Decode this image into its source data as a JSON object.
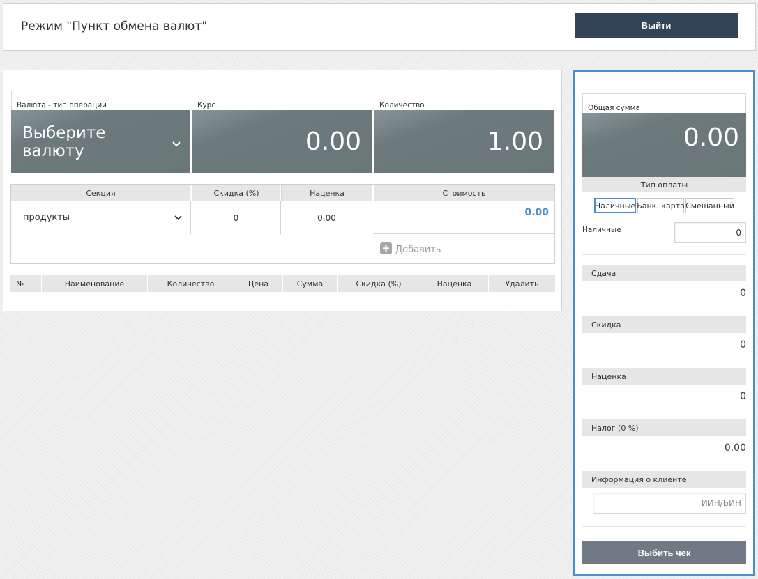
{
  "header": {
    "title": "Режим \"Пункт обмена валют\"",
    "logout_label": "Выйти"
  },
  "exchange": {
    "currency_label": "Валюта - тип операции",
    "currency_value": "Выберите валюту",
    "rate_label": "Курс",
    "rate_value": "0.00",
    "quantity_label": "Количество",
    "quantity_value": "1.00"
  },
  "item": {
    "section_label": "Секция",
    "section_value": "продукты",
    "discount_label": "Скидка (%)",
    "discount_value": "0",
    "markup_label": "Наценка",
    "markup_value": "0.00",
    "cost_label": "Стоимость",
    "cost_value": "0.00",
    "add_label": "Добавить"
  },
  "table": {
    "columns": [
      "№",
      "Наименование",
      "Количество",
      "Цена",
      "Сумма",
      "Скидка (%)",
      "Наценка",
      "Удалить"
    ]
  },
  "summary": {
    "total_label": "Общая сумма",
    "total_value": "0.00",
    "payment_type_label": "Тип оплаты",
    "payment_options": [
      "Наличные",
      "Банк. карта",
      "Смешанный"
    ],
    "cash_label": "Наличные",
    "cash_value": "0",
    "change_label": "Сдача",
    "change_value": "0",
    "discount_label": "Скидка",
    "discount_value": "0",
    "markup_label": "Наценка",
    "markup_value": "0",
    "tax_label": "Налог (0 %)",
    "tax_value": "0.00",
    "client_label": "Информация о клиенте",
    "client_placeholder": "ИИН/БИН",
    "print_label": "Выбить чек"
  },
  "colors": {
    "accent": "#4a8fcc",
    "header_button": "#324457",
    "tile": "#6a7777",
    "print_button": "#6f7a84",
    "cost_value": "#4a8fcc"
  },
  "icons": {
    "chevron": "chevron-down-icon",
    "add": "plus-square-icon"
  }
}
